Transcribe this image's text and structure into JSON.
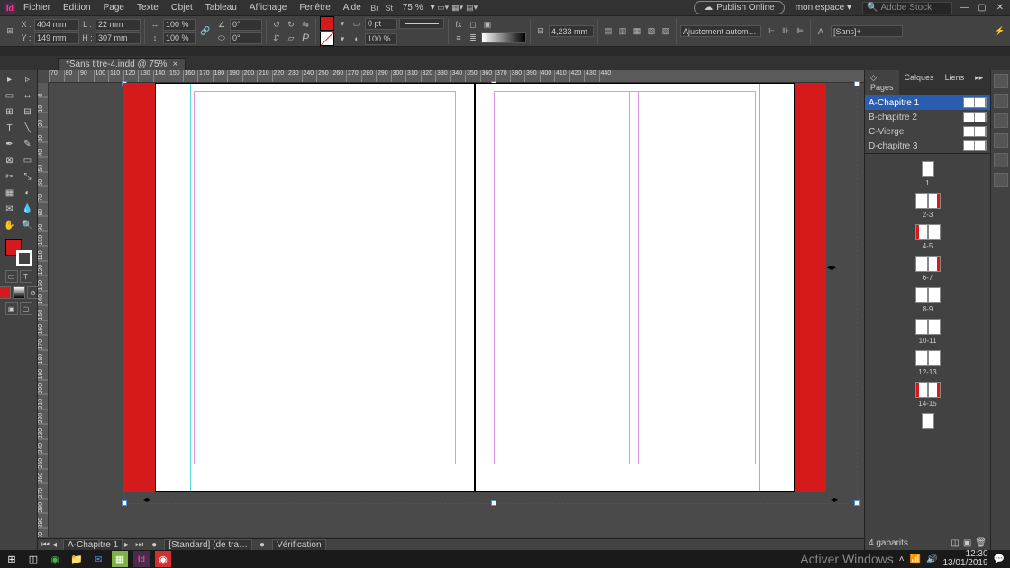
{
  "app_logo": "Id",
  "menu": {
    "file": "Fichier",
    "edit": "Edition",
    "page": "Page",
    "type": "Texte",
    "object": "Objet",
    "table": "Tableau",
    "view": "Affichage",
    "window": "Fenêtre",
    "help": "Aide"
  },
  "zoom": "75 %",
  "publish": "Publish Online",
  "workspace": "mon espace",
  "workspace_arrow": "▾",
  "search_placeholder": "Adobe Stock",
  "win": {
    "min": "—",
    "max": "▢",
    "close": "✕"
  },
  "ctrl": {
    "x_label": "X :",
    "x": "404 mm",
    "y_label": "Y :",
    "y": "149 mm",
    "w_label": "L :",
    "w": "22 mm",
    "h_label": "H :",
    "h": "307 mm",
    "sx": "100 %",
    "sy": "100 %",
    "rot": "0°",
    "shear": "0°",
    "stroke_weight": "0 pt",
    "opacity": "100 %",
    "gap": "4,233 mm",
    "fit": "Ajustement autom…",
    "font": "[Sans]+"
  },
  "doc_tab": "*Sans titre-4.indd @ 75%",
  "ruler_h": [
    "70",
    "80",
    "90",
    "100",
    "110",
    "120",
    "130",
    "140",
    "150",
    "160",
    "170",
    "180",
    "190",
    "200",
    "210",
    "220",
    "230",
    "240",
    "250",
    "260",
    "270",
    "280",
    "290",
    "300",
    "310",
    "320",
    "330",
    "340",
    "350",
    "360",
    "370",
    "380",
    "390",
    "400",
    "410",
    "420",
    "430",
    "440"
  ],
  "ruler_v": [
    "0",
    "10",
    "20",
    "30",
    "40",
    "50",
    "60",
    "70",
    "80",
    "90",
    "100",
    "110",
    "120",
    "130",
    "140",
    "150",
    "160",
    "170",
    "180",
    "190",
    "200",
    "210",
    "220",
    "230",
    "240",
    "250",
    "260",
    "270",
    "280",
    "290",
    "300"
  ],
  "panel": {
    "tabs": {
      "pages": "◇ Pages",
      "layers": "Calques",
      "links": "Liens"
    },
    "masters": [
      {
        "name": "A-Chapitre 1",
        "sel": true
      },
      {
        "name": "B-chapitre 2",
        "sel": false
      },
      {
        "name": "C-Vierge",
        "sel": false
      },
      {
        "name": "D-chapitre 3",
        "sel": false
      }
    ],
    "spreads": [
      {
        "label": "1",
        "pages": [
          "r"
        ]
      },
      {
        "label": "2-3",
        "pages": [
          "l",
          "r-red"
        ]
      },
      {
        "label": "4-5",
        "pages": [
          "l-red",
          "r"
        ]
      },
      {
        "label": "6-7",
        "pages": [
          "l",
          "r-red"
        ]
      },
      {
        "label": "8-9",
        "pages": [
          "l",
          "r"
        ]
      },
      {
        "label": "10-11",
        "pages": [
          "l",
          "r"
        ]
      },
      {
        "label": "12-13",
        "pages": [
          "l",
          "r"
        ]
      },
      {
        "label": "14-15",
        "pages": [
          "l-red",
          "r-red"
        ]
      },
      {
        "label": "",
        "pages": [
          "l"
        ]
      }
    ],
    "footer": "4 gabarits"
  },
  "status": {
    "current": "A-Chapitre 1",
    "preflight": "[Standard] (de tra…",
    "verif": "Vérification"
  },
  "taskbar": {
    "activate": "Activer Windows",
    "time": "12:30",
    "date": "13/01/2019"
  }
}
